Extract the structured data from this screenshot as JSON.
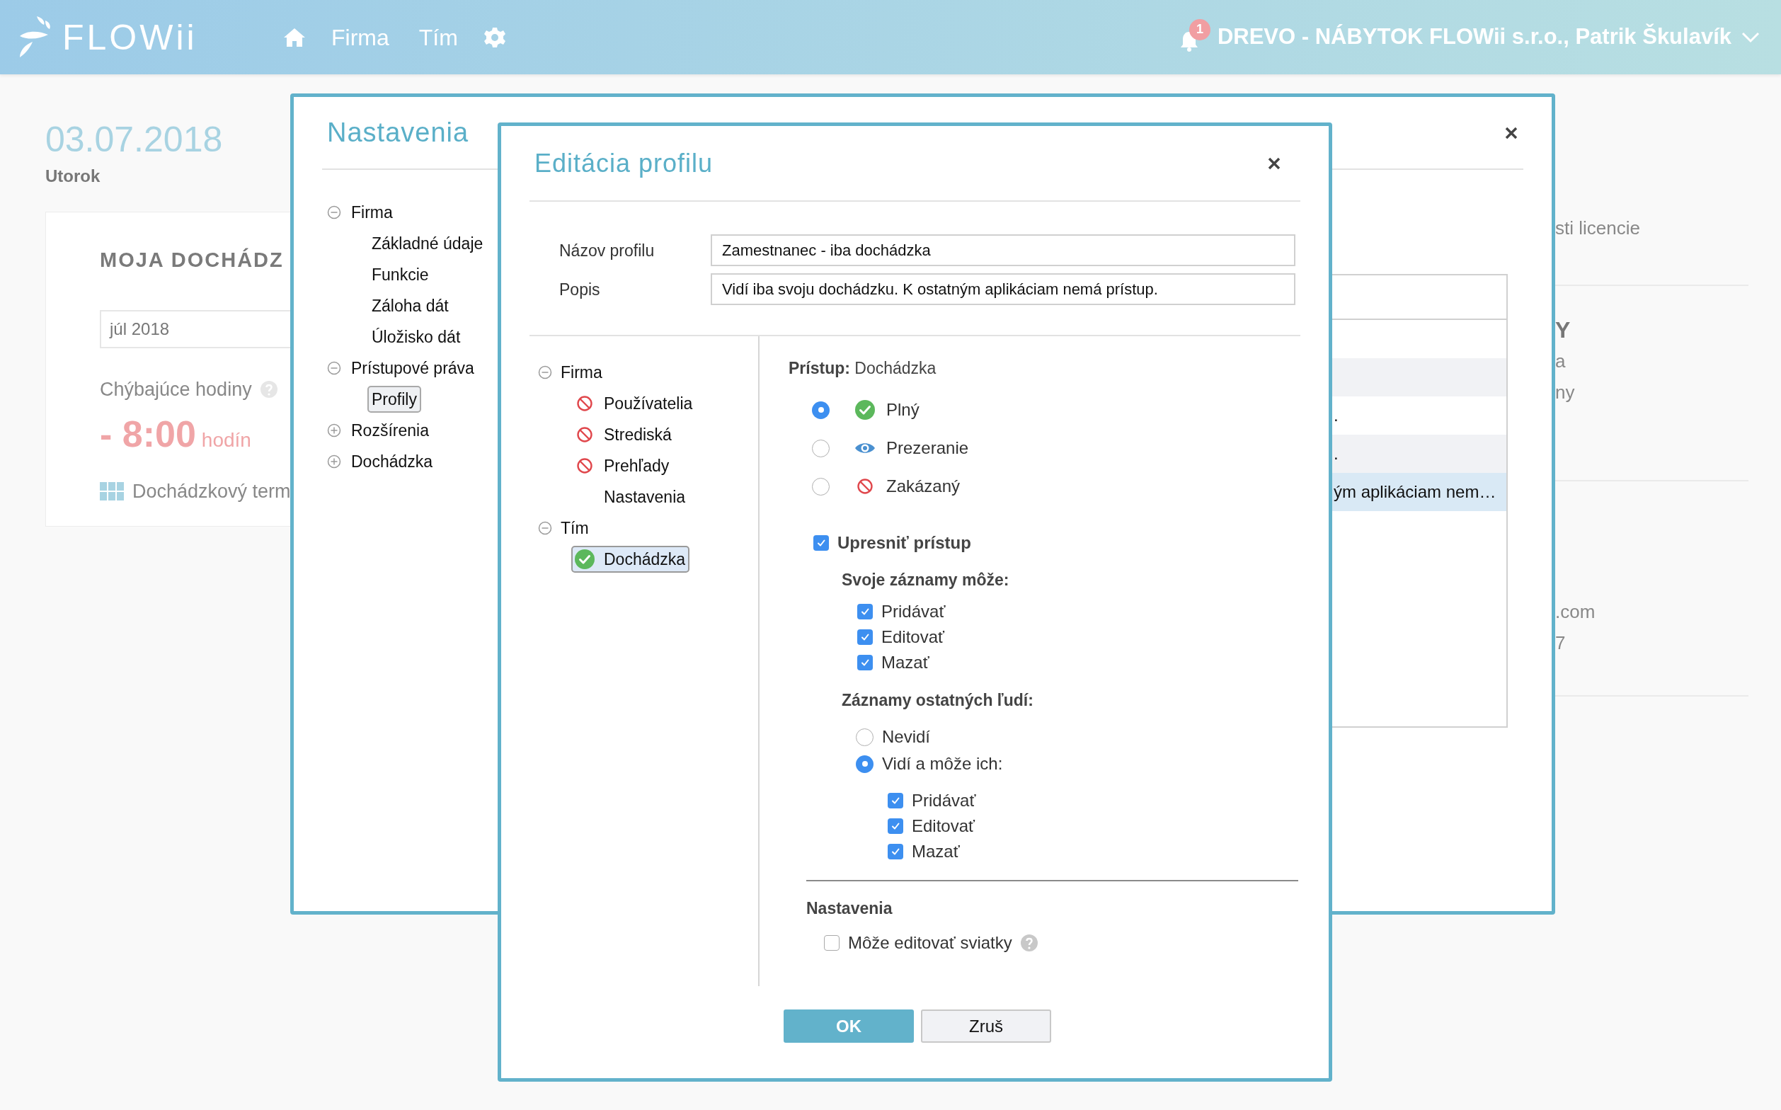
{
  "topbar": {
    "logo": "FLOWii",
    "nav": [
      "Firma",
      "Tím"
    ],
    "notification_count": "1",
    "account": "DREVO - NÁBYTOK FLOWii s.r.o., Patrik Škulavík"
  },
  "dashboard": {
    "date": "03.07.2018",
    "weekday": "Utorok",
    "card_title": "MOJA DOCHÁDZ",
    "month": "júl 2018",
    "missing_label": "Chýbajúce hodiny",
    "missing_value": "- 8:00",
    "missing_unit": "hodín",
    "terminal": "Dochádzkový term",
    "right_sections": [
      {
        "items": [
          {
            "kind": "text",
            "text": "sti licencie"
          }
        ]
      },
      {
        "items": [
          {
            "kind": "heading",
            "text": "Y"
          },
          {
            "kind": "text",
            "text": "a"
          },
          {
            "kind": "text",
            "text": "ny"
          }
        ]
      },
      {
        "items": [
          {
            "kind": "text",
            "text": ".com"
          },
          {
            "kind": "text",
            "text": "7"
          }
        ]
      }
    ]
  },
  "settings_dialog": {
    "title": "Nastavenia",
    "tree": [
      {
        "label": "Firma",
        "expanded": true,
        "children": [
          {
            "label": "Základné údaje",
            "selected": false
          },
          {
            "label": "Funkcie",
            "selected": false
          },
          {
            "label": "Záloha dát",
            "selected": false
          },
          {
            "label": "Úložisko dát",
            "selected": false
          }
        ]
      },
      {
        "label": "Prístupové práva",
        "expanded": true,
        "children": [
          {
            "label": "Profily",
            "selected": true
          }
        ]
      },
      {
        "label": "Rozšírenia",
        "expanded": false
      },
      {
        "label": "Dochádzka",
        "expanded": false
      }
    ],
    "table_rows": [
      {
        "selected": false
      },
      {
        "selected": false
      },
      {
        "text": ".",
        "selected": false
      },
      {
        "text": ".",
        "selected": false
      },
      {
        "text": "ým aplikáciam nem…",
        "selected": true
      }
    ]
  },
  "edit_dialog": {
    "title": "Editácia profilu",
    "fields": [
      {
        "label": "Názov profilu",
        "value": "Zamestnanec - iba dochádzka"
      },
      {
        "label": "Popis",
        "value": "Vidí iba svoju dochádzku. K ostatným aplikáciam nemá prístup."
      }
    ],
    "tree": [
      {
        "label": "Firma",
        "expanded": true,
        "children": [
          {
            "label": "Používatelia",
            "kind": "denied",
            "selected": false
          },
          {
            "label": "Strediská",
            "kind": "denied",
            "selected": false
          },
          {
            "label": "Prehľady",
            "kind": "denied",
            "selected": false
          },
          {
            "label": "Nastavenia",
            "kind": "plain",
            "selected": false
          }
        ]
      },
      {
        "label": "Tím",
        "expanded": true,
        "children": [
          {
            "label": "Dochádzka",
            "kind": "full",
            "selected": true
          }
        ]
      }
    ],
    "access_label": "Prístup:",
    "access_target": "Dochádzka",
    "access_options": [
      {
        "kind": "full",
        "label": "Plný",
        "selected": true
      },
      {
        "kind": "view",
        "label": "Prezeranie",
        "selected": false
      },
      {
        "kind": "denied",
        "label": "Zakázaný",
        "selected": false
      }
    ],
    "refine": {
      "label": "Upresniť prístup",
      "checked": true
    },
    "own_title": "Svoje záznamy môže:",
    "own": [
      {
        "label": "Pridávať",
        "checked": true
      },
      {
        "label": "Editovať",
        "checked": true
      },
      {
        "label": "Mazať",
        "checked": true
      }
    ],
    "others_title": "Záznamy ostatných ľudí:",
    "others_options": [
      {
        "label": "Nevidí",
        "selected": false
      },
      {
        "label": "Vidí a môže ich:",
        "selected": true
      }
    ],
    "others": [
      {
        "label": "Pridávať",
        "checked": true
      },
      {
        "label": "Editovať",
        "checked": true
      },
      {
        "label": "Mazať",
        "checked": true
      }
    ],
    "settings_title": "Nastavenia",
    "settings": [
      {
        "label": "Môže editovať sviatky",
        "checked": false
      }
    ],
    "buttons": [
      {
        "kind": "primary",
        "label": "OK"
      },
      {
        "kind": "secondary",
        "label": "Zruš"
      }
    ]
  }
}
